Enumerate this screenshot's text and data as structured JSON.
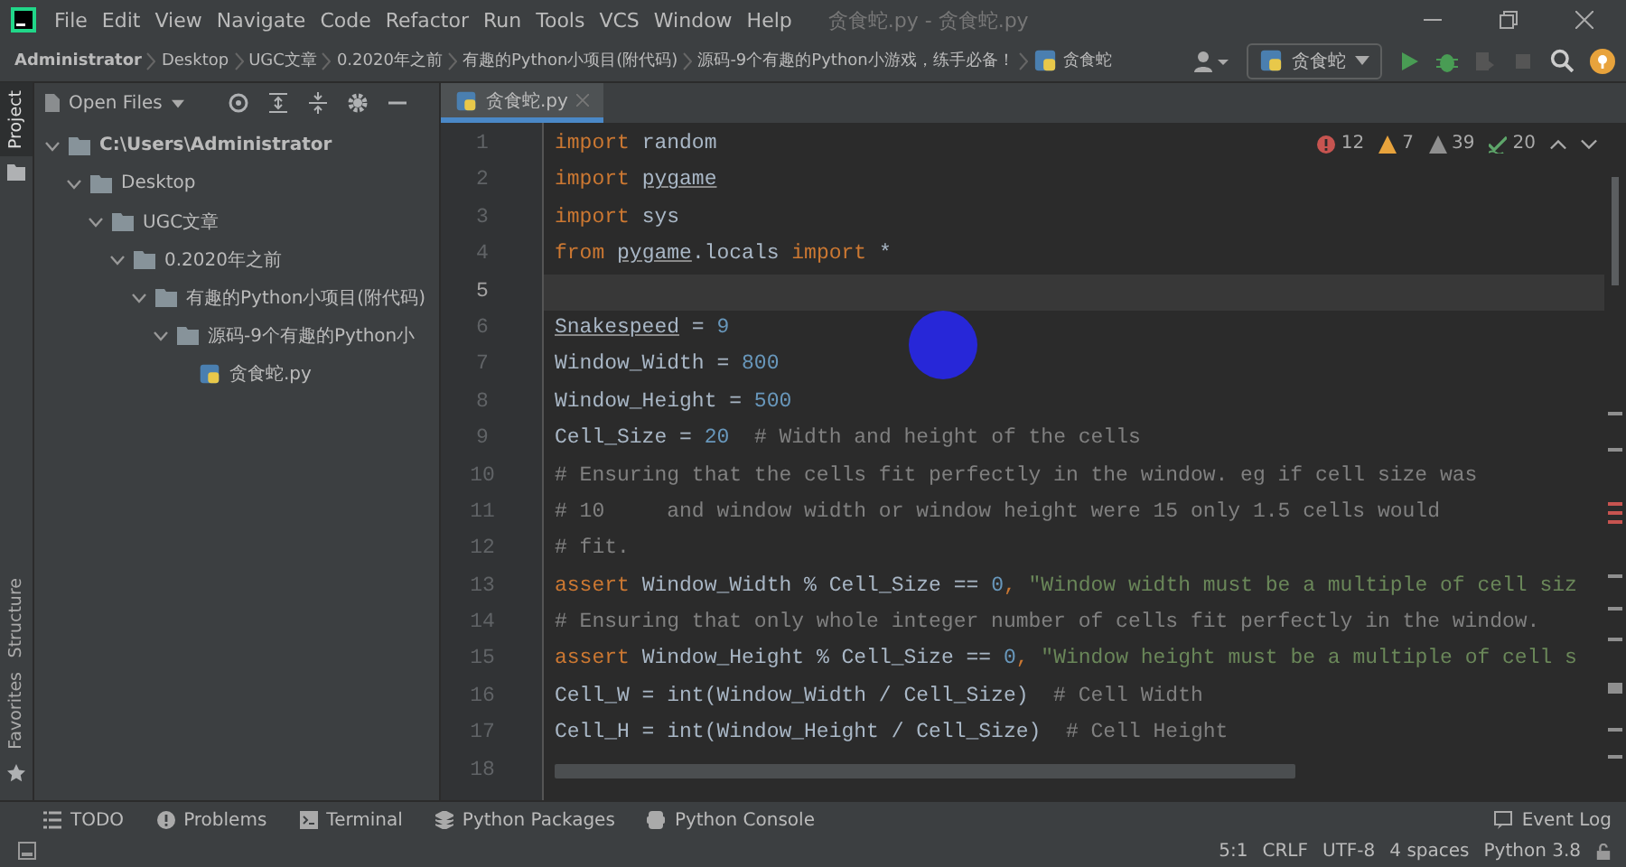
{
  "window": {
    "title": "贪食蛇.py - 贪食蛇.py"
  },
  "menu": [
    "File",
    "Edit",
    "View",
    "Navigate",
    "Code",
    "Refactor",
    "Run",
    "Tools",
    "VCS",
    "Window",
    "Help"
  ],
  "breadcrumbs": [
    {
      "label": "Administrator",
      "bold": true
    },
    {
      "label": "Desktop",
      "bold": false
    },
    {
      "label": "UGC文章",
      "bold": false
    },
    {
      "label": "0.2020年之前",
      "bold": false
    },
    {
      "label": "有趣的Python小项目(附代码)",
      "bold": false
    },
    {
      "label": "源码-9个有趣的Python小游戏，练手必备！",
      "bold": false
    },
    {
      "label": "贪食蛇",
      "bold": false
    }
  ],
  "run_config": {
    "label": "贪食蛇"
  },
  "side_tabs": {
    "top": [
      {
        "label": "Project",
        "selected": true
      }
    ],
    "bottom": [
      {
        "label": "Structure",
        "selected": false
      },
      {
        "label": "Favorites",
        "selected": false
      }
    ]
  },
  "project_panel": {
    "view": "Open Files",
    "tree": [
      {
        "label": "C:\\Users\\Administrator",
        "kind": "folder",
        "expanded": true,
        "children": [
          {
            "label": "Desktop",
            "kind": "folder",
            "expanded": true,
            "children": [
              {
                "label": "UGC文章",
                "kind": "folder",
                "expanded": true,
                "children": [
                  {
                    "label": "0.2020年之前",
                    "kind": "folder",
                    "expanded": true,
                    "children": [
                      {
                        "label": "有趣的Python小项目(附代码)",
                        "kind": "folder",
                        "expanded": true,
                        "children": [
                          {
                            "label": "源码-9个有趣的Python小",
                            "kind": "folder",
                            "expanded": true,
                            "children": [
                              {
                                "label": "贪食蛇.py",
                                "kind": "python"
                              }
                            ]
                          }
                        ]
                      }
                    ]
                  }
                ]
              }
            ]
          }
        ]
      }
    ]
  },
  "editor_tabs": [
    {
      "label": "贪食蛇.py",
      "selected": true
    }
  ],
  "inspections": [
    {
      "kind": "error",
      "count": "12"
    },
    {
      "kind": "warning",
      "count": "7"
    },
    {
      "kind": "weak",
      "count": "39"
    },
    {
      "kind": "typo",
      "count": "20"
    }
  ],
  "code_lines": [
    {
      "number": "1",
      "current": false,
      "tokens": [
        {
          "kind": "kw",
          "text": "import"
        },
        {
          "kind": "plain",
          "text": " random"
        }
      ]
    },
    {
      "number": "2",
      "current": false,
      "tokens": [
        {
          "kind": "kw",
          "text": "import "
        },
        {
          "kind": "flagged",
          "text": "pygame"
        }
      ]
    },
    {
      "number": "3",
      "current": false,
      "tokens": [
        {
          "kind": "kw",
          "text": "import"
        },
        {
          "kind": "plain",
          "text": " sys"
        }
      ]
    },
    {
      "number": "4",
      "current": false,
      "tokens": [
        {
          "kind": "kw",
          "text": "from "
        },
        {
          "kind": "flagged",
          "text": "pygame"
        },
        {
          "kind": "plain",
          "text": ".locals "
        },
        {
          "kind": "kw",
          "text": "import"
        },
        {
          "kind": "plain",
          "text": " *"
        }
      ]
    },
    {
      "number": "5",
      "current": true
    },
    {
      "number": "6",
      "current": false,
      "tokens": [
        {
          "kind": "flagged",
          "text": "Snakespeed"
        },
        {
          "kind": "plain",
          "text": " = "
        },
        {
          "kind": "num",
          "text": "9"
        }
      ]
    },
    {
      "number": "7",
      "current": false,
      "tokens": [
        {
          "kind": "plain",
          "text": "Window_Width = "
        },
        {
          "kind": "num",
          "text": "800"
        }
      ]
    },
    {
      "number": "8",
      "current": false,
      "tokens": [
        {
          "kind": "plain",
          "text": "Window_Height = "
        },
        {
          "kind": "num",
          "text": "500"
        }
      ]
    },
    {
      "number": "9",
      "current": false,
      "tokens": [
        {
          "kind": "plain",
          "text": "Cell_Size = "
        },
        {
          "kind": "num",
          "text": "20"
        },
        {
          "kind": "cmt",
          "text": "  # Width and height of the cells"
        }
      ]
    },
    {
      "number": "10",
      "current": false,
      "tokens": [
        {
          "kind": "cmt",
          "text": "# Ensuring that the cells fit perfectly in the window. eg if cell size was"
        }
      ]
    },
    {
      "number": "11",
      "current": false,
      "tokens": [
        {
          "kind": "cmt",
          "text": "# 10     and window width or window height were 15 only 1.5 cells would"
        }
      ]
    },
    {
      "number": "12",
      "current": false,
      "tokens": [
        {
          "kind": "cmt",
          "text": "# fit."
        }
      ]
    },
    {
      "number": "13",
      "current": false,
      "tokens": [
        {
          "kind": "kw",
          "text": "assert"
        },
        {
          "kind": "plain",
          "text": " Window_Width % Cell_Size == "
        },
        {
          "kind": "num",
          "text": "0"
        },
        {
          "kind": "kw",
          "text": ","
        },
        {
          "kind": "str",
          "text": " \"Window width must be a multiple of cell siz"
        }
      ]
    },
    {
      "number": "14",
      "current": false,
      "tokens": [
        {
          "kind": "cmt",
          "text": "# Ensuring that only whole integer number of cells fit perfectly in the window."
        }
      ]
    },
    {
      "number": "15",
      "current": false,
      "tokens": [
        {
          "kind": "kw",
          "text": "assert"
        },
        {
          "kind": "plain",
          "text": " Window_Height % Cell_Size == "
        },
        {
          "kind": "num",
          "text": "0"
        },
        {
          "kind": "kw",
          "text": ","
        },
        {
          "kind": "str",
          "text": " \"Window height must be a multiple of cell s"
        }
      ]
    },
    {
      "number": "16",
      "current": false,
      "tokens": [
        {
          "kind": "plain",
          "text": "Cell_W = int(Window_Width / Cell_Size)"
        },
        {
          "kind": "cmt",
          "text": "  # Cell Width"
        }
      ]
    },
    {
      "number": "17",
      "current": false,
      "tokens": [
        {
          "kind": "plain",
          "text": "Cell_H = int(Window_Height / Cell_Size)"
        },
        {
          "kind": "cmt",
          "text": "  # Cell Height"
        }
      ]
    },
    {
      "number": "18",
      "current": false
    }
  ],
  "tool_tabs": [
    {
      "kind": "todo",
      "label": "TODO"
    },
    {
      "kind": "problems",
      "label": "Problems"
    },
    {
      "kind": "terminal",
      "label": "Terminal"
    },
    {
      "kind": "packages",
      "label": "Python Packages"
    },
    {
      "kind": "console",
      "label": "Python Console"
    },
    {
      "kind": "log",
      "label": "Event Log"
    }
  ],
  "status": [
    "5:1",
    "CRLF",
    "UTF-8",
    "4 spaces",
    "Python 3.8"
  ]
}
